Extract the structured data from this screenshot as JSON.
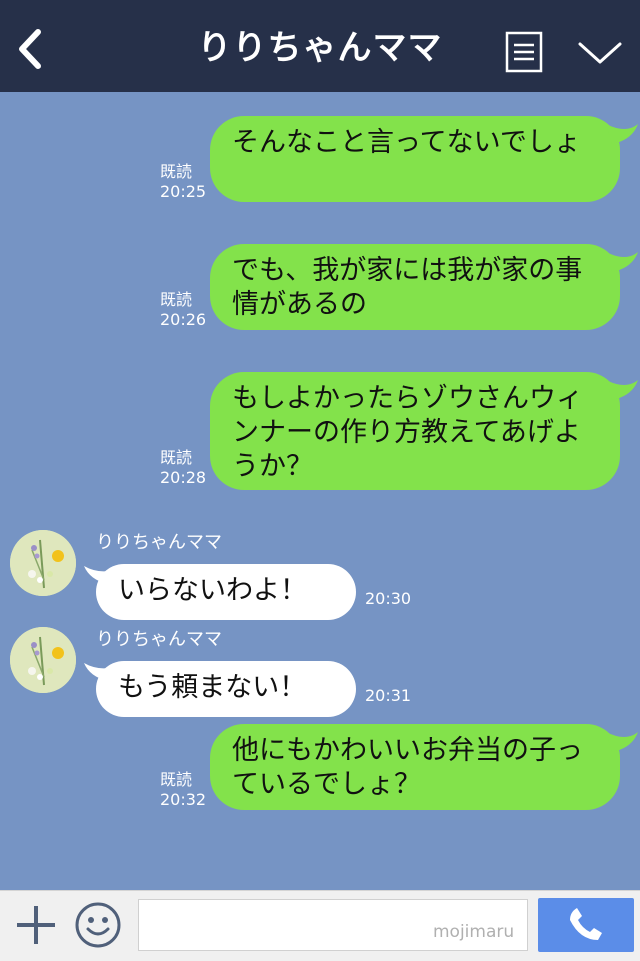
{
  "header": {
    "title": "りりちゃんママ"
  },
  "messages": [
    {
      "dir": "out",
      "text": "そんなこと言ってないでしょ",
      "read": "既読",
      "time": "20:25"
    },
    {
      "dir": "out",
      "text": "でも、我が家には我が家の事情があるの",
      "read": "既読",
      "time": "20:26"
    },
    {
      "dir": "out",
      "text": "もしよかったらゾウさんウィンナーの作り方教えてあげようか？",
      "read": "既読",
      "time": "20:28"
    },
    {
      "dir": "in",
      "sender": "りりちゃんママ",
      "text": "いらないわよ！",
      "time": "20:30"
    },
    {
      "dir": "in",
      "sender": "りりちゃんママ",
      "text": "もう頼まない！",
      "time": "20:31"
    },
    {
      "dir": "out",
      "text": "他にもかわいいお弁当の子っているでしょ？",
      "read": "既読",
      "time": "20:32"
    }
  ],
  "input": {
    "placeholder": ""
  },
  "watermark": "mojimaru",
  "colors": {
    "background": "#7694c4",
    "header": "#263049",
    "bubble_out": "#83e24b",
    "bubble_in": "#ffffff",
    "call_button": "#5b8de8"
  },
  "icons": {
    "back": "chevron-left-icon",
    "menu": "list-icon",
    "collapse": "chevron-down-icon",
    "add": "plus-icon",
    "sticker": "smiley-icon",
    "call": "phone-icon"
  }
}
